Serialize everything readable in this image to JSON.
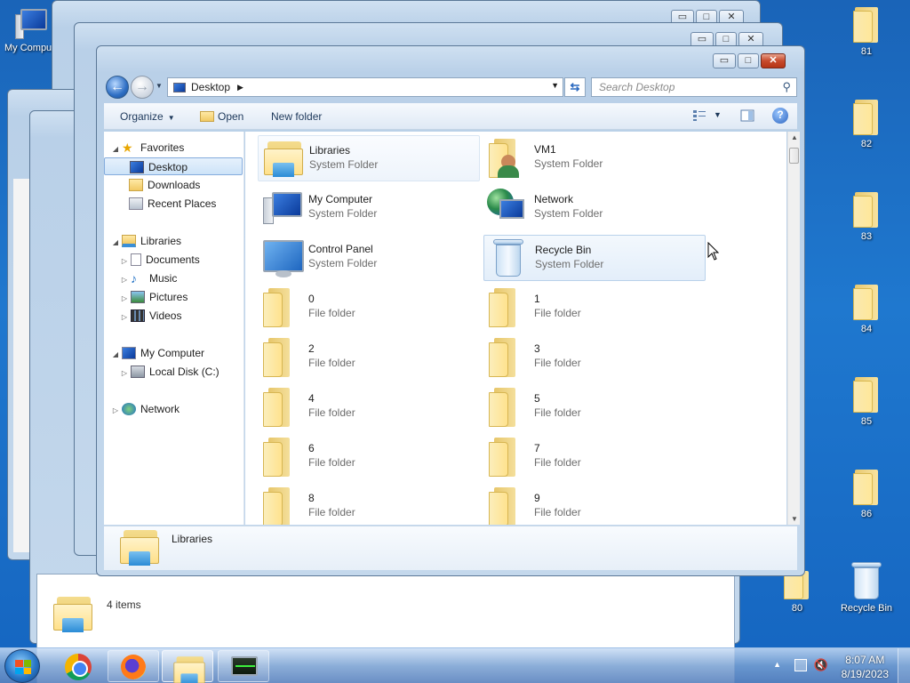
{
  "desktop": {
    "icons": [
      {
        "label": "My Compu",
        "kind": "computer"
      },
      {
        "label": "81",
        "kind": "folder"
      },
      {
        "label": "82",
        "kind": "folder"
      },
      {
        "label": "83",
        "kind": "folder"
      },
      {
        "label": "84",
        "kind": "folder"
      },
      {
        "label": "85",
        "kind": "folder"
      },
      {
        "label": "86",
        "kind": "folder"
      },
      {
        "label": "80",
        "kind": "folder"
      },
      {
        "label": "Recycle Bin",
        "kind": "recycle-bin"
      }
    ]
  },
  "back_window": {
    "status_text": "4 items"
  },
  "explorer": {
    "title_buttons": {
      "minimize": "▭",
      "maximize": "□",
      "close": "✕"
    },
    "address": {
      "location": "Desktop"
    },
    "search": {
      "placeholder": "Search Desktop"
    },
    "toolbar": {
      "organize": "Organize",
      "open": "Open",
      "new_folder": "New folder"
    },
    "nav": {
      "favorites": "Favorites",
      "desktop": "Desktop",
      "downloads": "Downloads",
      "recent_places": "Recent Places",
      "libraries": "Libraries",
      "documents": "Documents",
      "music": "Music",
      "pictures": "Pictures",
      "videos": "Videos",
      "my_computer": "My Computer",
      "local_disk": "Local Disk (C:)",
      "network": "Network"
    },
    "items": [
      {
        "name": "Libraries",
        "type": "System Folder",
        "icon": "libraries-icon"
      },
      {
        "name": "VM1",
        "type": "System Folder",
        "icon": "user-folder-icon"
      },
      {
        "name": "My Computer",
        "type": "System Folder",
        "icon": "computer-icon"
      },
      {
        "name": "Network",
        "type": "System Folder",
        "icon": "network-icon"
      },
      {
        "name": "Control Panel",
        "type": "System Folder",
        "icon": "control-panel-icon"
      },
      {
        "name": "Recycle Bin",
        "type": "System Folder",
        "icon": "recycle-bin-icon"
      },
      {
        "name": "0",
        "type": "File folder",
        "icon": "folder-icon"
      },
      {
        "name": "1",
        "type": "File folder",
        "icon": "folder-icon"
      },
      {
        "name": "2",
        "type": "File folder",
        "icon": "folder-icon"
      },
      {
        "name": "3",
        "type": "File folder",
        "icon": "folder-icon"
      },
      {
        "name": "4",
        "type": "File folder",
        "icon": "folder-icon"
      },
      {
        "name": "5",
        "type": "File folder",
        "icon": "folder-icon"
      },
      {
        "name": "6",
        "type": "File folder",
        "icon": "folder-icon"
      },
      {
        "name": "7",
        "type": "File folder",
        "icon": "folder-icon"
      },
      {
        "name": "8",
        "type": "File folder",
        "icon": "folder-icon"
      },
      {
        "name": "9",
        "type": "File folder",
        "icon": "folder-icon"
      }
    ],
    "details": {
      "name": "Libraries"
    }
  },
  "taskbar": {
    "apps": [
      "start-button",
      "chrome",
      "firefox",
      "windows-explorer",
      "task-manager"
    ],
    "clock": {
      "time": "8:07 AM",
      "date": "8/19/2023"
    }
  },
  "colors": {
    "desktop": "#1f78cf",
    "selection": "#cde3f8",
    "window_frame": "#b9d0e8"
  }
}
